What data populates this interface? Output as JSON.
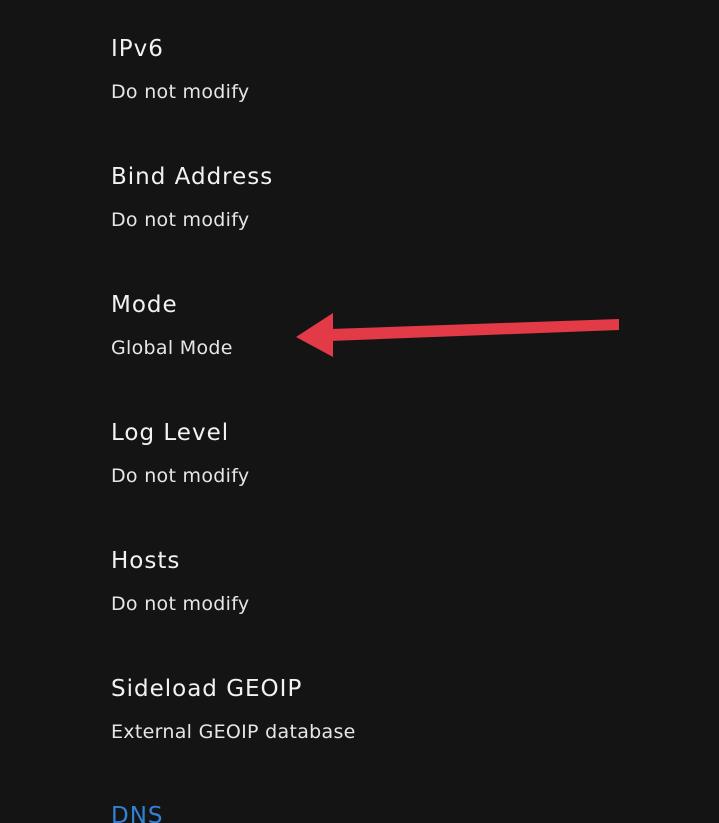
{
  "settings": {
    "items": [
      {
        "title": "IPv6",
        "summary": "Do not modify"
      },
      {
        "title": "Bind Address",
        "summary": "Do not modify"
      },
      {
        "title": "Mode",
        "summary": "Global Mode"
      },
      {
        "title": "Log Level",
        "summary": "Do not modify"
      },
      {
        "title": "Hosts",
        "summary": "Do not modify"
      },
      {
        "title": "Sideload GEOIP",
        "summary": "External GEOIP database"
      }
    ],
    "next_section_header": "DNS"
  },
  "colors": {
    "background": "#141414",
    "text_primary": "#f2f2f2",
    "section_header": "#2f82d6",
    "annotation_arrow": "#e23a47"
  },
  "annotation": {
    "icon": "arrow-left-icon",
    "points_to": "Mode"
  }
}
